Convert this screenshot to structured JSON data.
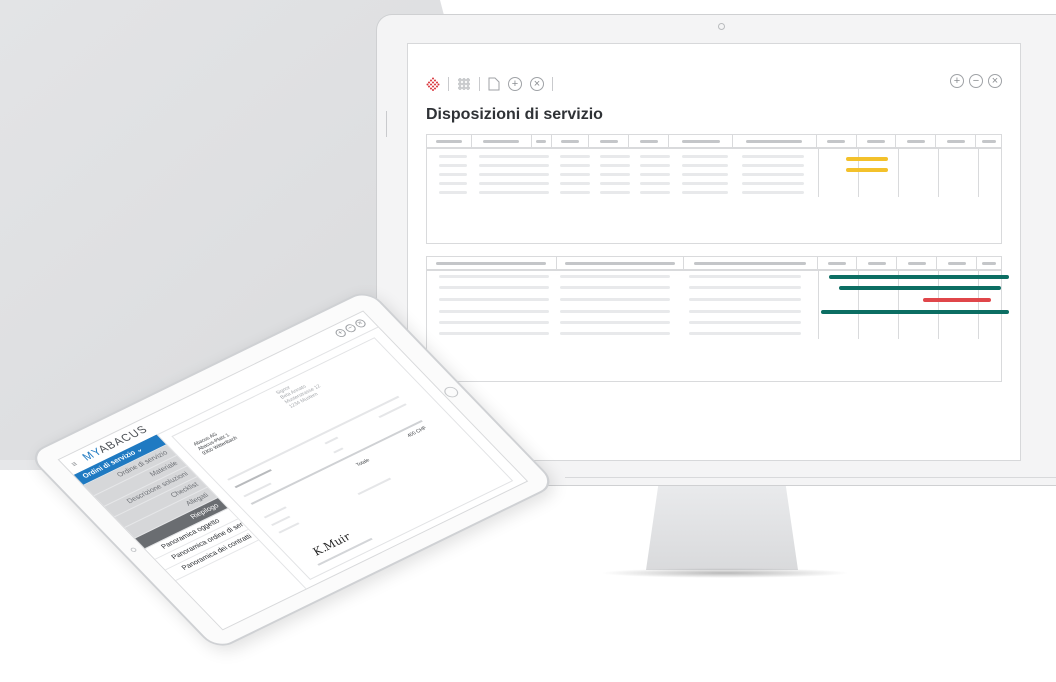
{
  "monitor": {
    "page_title": "Disposizioni di servizio",
    "toolbar": {
      "logo_icon": "abacus-logo-icon",
      "icons": [
        "grid-icon",
        "document-icon",
        "add-circle-icon",
        "close-circle-icon"
      ],
      "window_controls": [
        "add-circle-icon",
        "minus-circle-icon",
        "close-circle-icon"
      ],
      "glyphs": {
        "add": "+",
        "minus": "−",
        "close": "×",
        "grid": "⋮⋮⋮",
        "doc": "▯"
      }
    },
    "gantt_colors": {
      "yellow": "#f3c12b",
      "teal": "#0c6e63",
      "red": "#e0464a"
    }
  },
  "tablet": {
    "brand_prefix": "MY",
    "brand_suffix": "ABACUS",
    "menu_glyph": "≡",
    "window_glyphs": [
      "+",
      "−",
      "×"
    ],
    "sidebar": [
      {
        "label": "Ordini di servizio ⌄",
        "style": "active"
      },
      {
        "label": "Ordine di servizio",
        "style": "sub"
      },
      {
        "label": "Materiale",
        "style": "sub"
      },
      {
        "label": "Descrizione soluzioni",
        "style": "sub"
      },
      {
        "label": "Checklist",
        "style": "sub"
      },
      {
        "label": "Allegati",
        "style": "sub"
      },
      {
        "label": "Riepilogo",
        "style": "dark"
      },
      {
        "label": "Panoramica oggetto",
        "style": "plain"
      },
      {
        "label": "Panoramica ordine di serv.",
        "style": "plain"
      },
      {
        "label": "Panoramica dei contratti",
        "style": "plain"
      }
    ],
    "doc": {
      "sender": [
        "Abacus AG",
        "Abacus-Platz 1",
        "9300 Wittenbach"
      ],
      "recipient": [
        "Signor",
        "Beta Annato",
        "Musterstrasse 12",
        "1234 Mustern"
      ],
      "total_label": "Totale",
      "total_value": "400 CHF",
      "signature": "K.Muir"
    }
  }
}
